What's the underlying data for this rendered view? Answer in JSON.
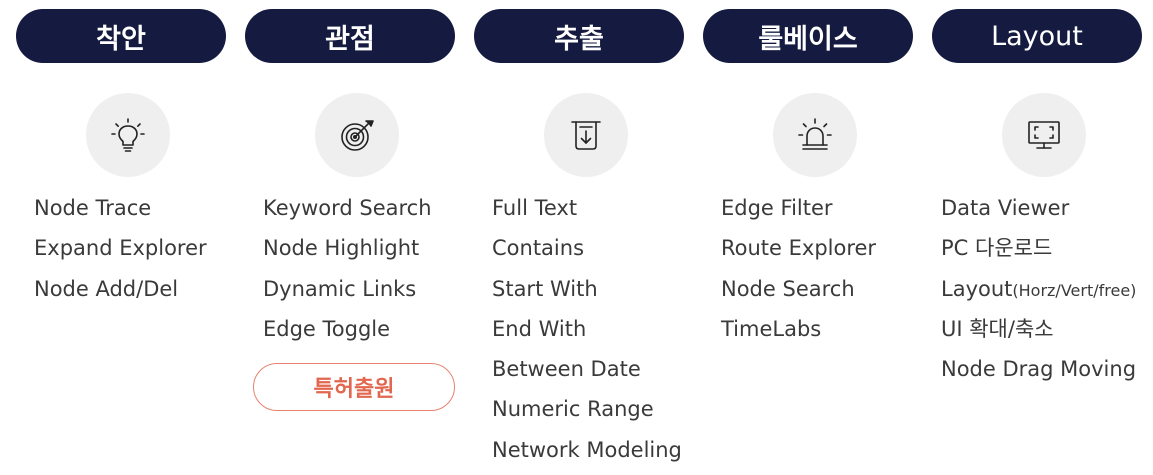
{
  "columns": [
    {
      "header": "착안",
      "icon": "lightbulb-icon",
      "items": [
        "Node Trace",
        "Expand Explorer",
        "Node Add/Del"
      ]
    },
    {
      "header": "관점",
      "icon": "target-icon",
      "items": [
        "Keyword Search",
        "Node Highlight",
        "Dynamic Links",
        "Edge Toggle"
      ],
      "badge": "특허출원"
    },
    {
      "header": "추출",
      "icon": "extract-download-icon",
      "items": [
        "Full Text",
        "Contains",
        "Start With",
        "End With",
        "Between Date",
        "Numeric Range",
        "Network Modeling"
      ]
    },
    {
      "header": "룰베이스",
      "icon": "alarm-siren-icon",
      "items": [
        "Edge Filter",
        "Route Explorer",
        "Node Search",
        "TimeLabs"
      ]
    },
    {
      "header": "Layout",
      "icon": "monitor-fullscreen-icon",
      "items": [
        "Data Viewer",
        "PC 다운로드",
        "Layout",
        "UI 확대/축소",
        "Node Drag Moving"
      ],
      "layout_suffix": "(Horz/Vert/free)"
    }
  ],
  "colors": {
    "header_bg": "#141a40",
    "header_text": "#ffffff",
    "icon_circle_bg": "#efeff0",
    "badge_accent": "#e2674f",
    "body_text": "#3a3a3a"
  }
}
